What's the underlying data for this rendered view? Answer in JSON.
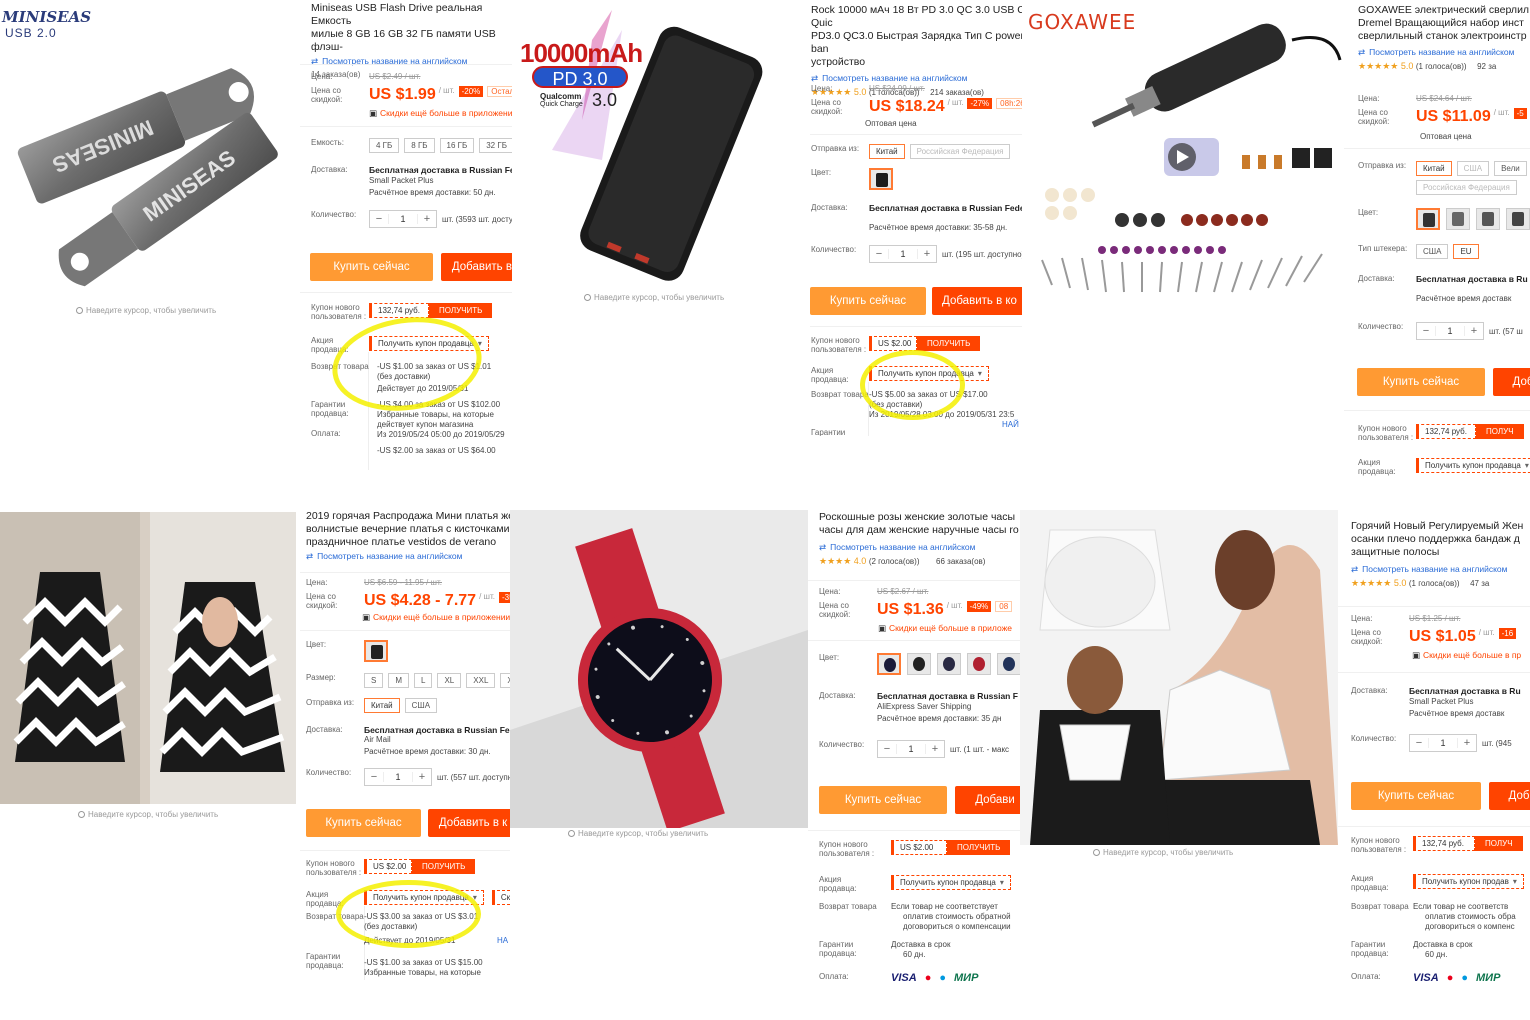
{
  "ui": {
    "zoom_hint": "Наведите курсор, чтобы увеличить",
    "view_english": "Посмотреть название на английском",
    "buy_now": "Купить сейчас",
    "add_to_cart": "Добавить в к",
    "get": "ПОЛУЧИТЬ",
    "get_seller_coupon": "Получить купон продавца"
  },
  "labels": {
    "price": "Цена:",
    "price_discount": "Цена со скидкой:",
    "capacity": "Емкость:",
    "delivery": "Доставка:",
    "quantity": "Количество:",
    "ship_from": "Отправка из:",
    "color": "Цвет:",
    "size": "Размер:",
    "plug_type": "Тип штекера:",
    "new_user_coupon": "Купон нового пользователя :",
    "seller_promo": "Акция продавца:",
    "return": "Возврат товара",
    "guarantee": "Гарантии продавца:",
    "payment": "Оплата:"
  },
  "p1": {
    "logo": "MINISEAS",
    "logo_sub": "USB 2.0",
    "title": "Miniseas USB Flash Drive реальная Емкость\nмилые 8 GB 16 GB 32 ГБ памяти USB флэш-",
    "orders": "14 заказа(ов)",
    "old_price": "US $2.49 / шт.",
    "price": "US $1.99",
    "unit": "/ шт.",
    "discount": "-20%",
    "timer": "Остал",
    "app_discount": "Скидки ещё больше в приложении",
    "capacities": [
      "4 ГБ",
      "8 ГБ",
      "16 ГБ",
      "32 ГБ"
    ],
    "shipping": "Бесплатная доставка в Russian Fede",
    "shipping_method": "Small Packet Plus",
    "eta": "Расчётное время доставки: 50 дн.",
    "qty": "1",
    "stock": "шт. (3593 шт. досту",
    "coupon": "132,74 руб.",
    "promo_line1": "-US $1.00 за заказ от US $1.01",
    "promo_line2": "(без доставки)",
    "promo_line3": "Действует до 2019/05/31",
    "g_line1": "-US $4.00 за заказ от US $102.00",
    "g_line2": "Избранные товары, на которые",
    "g_line3": "действует купон магазина",
    "g_line4": "Из 2019/05/24 05:00 до 2019/05/29",
    "g_line5": "-US $2.00 за заказ от US $64.00"
  },
  "p2": {
    "mah": "10000mAh",
    "pd": "PD 3.0",
    "qc_brand": "Qualcomm",
    "qc_sub": "Quick Charge",
    "qc_ver": "3.0"
  },
  "p3": {
    "title": "Rock 10000 мАч 18 Вт PD 3.0 QC 3.0 USB C Quic\nPD3.0 QC3.0 Быстрая Зарядка Тип С power ban\nустройство",
    "rating": "★★★★★ 5.0",
    "votes": "(1 голоса(ов))",
    "orders": "214 заказа(ов)",
    "old_price": "US $24.99 / шт.",
    "price": "US $18.24",
    "unit": "/ шт.",
    "discount": "-27%",
    "timer": "08h:26m",
    "wholesale": "Оптовая цена",
    "from": [
      "Китай",
      "Российская Федерация"
    ],
    "shipping": "Бесплатная доставка в Russian Federati",
    "eta": "Расчётное время доставки: 35-58 дн.",
    "qty": "1",
    "stock": "шт. (195 шт. доступно)",
    "add_cart": "Добавить в ко",
    "coupon": "US $2.00",
    "promo_line1": "-US $5.00 за заказ от US $17.00",
    "promo_line2": "(без доставки)",
    "promo_line3": "Из 2019/05/28 03:00 до 2019/05/31 23:5",
    "more": "НАЙ"
  },
  "p4": {
    "logo": "GOXAWEE"
  },
  "p5": {
    "title": "GOXAWEE электрический сверлил\nDremel Вращающийся набор инст\nсверлильный станок электроинстр",
    "rating": "★★★★★ 5.0",
    "votes": "(1 голоса(ов))",
    "orders": "92 за",
    "old_price": "US $24.64 / шт.",
    "price": "US $11.09",
    "unit": "/ шт.",
    "discount": "-5",
    "wholesale": "Оптовая цена",
    "from": [
      "Китай",
      "США",
      "Вели",
      "Российская Федерация"
    ],
    "plugs": [
      "США",
      "EU"
    ],
    "shipping": "Бесплатная доставка в Ru",
    "eta": "Расчётное время доставк",
    "qty": "1",
    "stock": "шт. (57 ш",
    "add_cart": "Доб",
    "coupon": "132,74 руб.",
    "get": "ПОЛУЧ"
  },
  "p6": {
    "title": "2019 горячая Распродажа Мини платья жен\nволнистые вечерние платья с кисточками н\nпраздничное платье vestidos de verano",
    "old_price": "US $6.59 - 11.95 / шт.",
    "price": "US $4.28 - 7.77",
    "unit": "/ шт.",
    "discount": "-35%",
    "app_discount": "Скидки ещё больше в приложении",
    "sizes": [
      "S",
      "M",
      "L",
      "XL",
      "XXL",
      "XXX"
    ],
    "from": [
      "Китай",
      "США"
    ],
    "shipping": "Бесплатная доставка в Russian Federa",
    "shipping_method": "Air Mail",
    "eta": "Расчётное время доставки: 30 дн.",
    "qty": "1",
    "stock": "шт. (557 шт. доступно",
    "coupon": "US $2.00",
    "extra": "Ски",
    "promo_line1": "-US $3.00 за заказ от US $3.01",
    "promo_line2": "(без доставки)",
    "promo_line3": "Действует до 2019/05/31",
    "more": "НА",
    "g_line1": "-US $1.00 за заказ от US $15.00",
    "g_line2": "Избранные товары, на которые"
  },
  "p8": {
    "title": "Роскошные розы женские золотые часы\nчасы для дам женские наручные часы ro",
    "rating": "★★★★ 4.0",
    "votes": "(2 голоса(ов))",
    "orders": "66 заказа(ов)",
    "old_price": "US $2.67 / шт.",
    "price": "US $1.36",
    "unit": "/ шт.",
    "discount": "-49%",
    "timer": "08",
    "app_discount": "Скидки ещё больше в приложе",
    "shipping": "Бесплатная доставка в Russian F",
    "shipping_method": "AliExpress Saver Shipping",
    "eta": "Расчётное время доставки: 35 дн",
    "qty": "1",
    "stock": "шт. (1 шт. - макс",
    "add_cart": "Добави",
    "coupon": "US $2.00",
    "return1": "Если товар не соответствует",
    "return2": "оплатив стоимость обратной",
    "return3": "договориться о компенсации",
    "guar1": "Доставка в срок",
    "guar2": "60 дн.",
    "pay": [
      "VISA",
      "MC",
      "MC",
      "МИР"
    ]
  },
  "p10": {
    "title": "Горячий Новый Регулируемый Жен\nосанки плечо поддержка бандаж д\nзащитные полосы",
    "rating": "★★★★★ 5.0",
    "votes": "(1 голоса(ов))",
    "orders": "47 за",
    "old_price": "US $1.25 / шт.",
    "price": "US $1.05",
    "unit": "/ шт.",
    "discount": "-16",
    "app_discount": "Скидки ещё больше в пр",
    "shipping": "Бесплатная доставка в Ru",
    "shipping_method": "Small Packet Plus",
    "eta": "Расчётное время доставк",
    "qty": "1",
    "stock": "шт. (945",
    "add_cart": "Доб",
    "coupon": "132,74 руб.",
    "get": "ПОЛУЧ",
    "promo": "Получить купон продав",
    "return1": "Если товар не соответств",
    "return2": "оплатив стоимость обра",
    "return3": "договориться о компенс",
    "guar1": "Доставка в срок",
    "guar2": "60 дн.",
    "pay": [
      "VISA",
      "MC",
      "MC",
      "МИР"
    ]
  },
  "colors": {
    "accent": "#ff4400",
    "buy": "#ff9a33",
    "highlight": "#f5f000",
    "link": "#2a6bd6"
  }
}
